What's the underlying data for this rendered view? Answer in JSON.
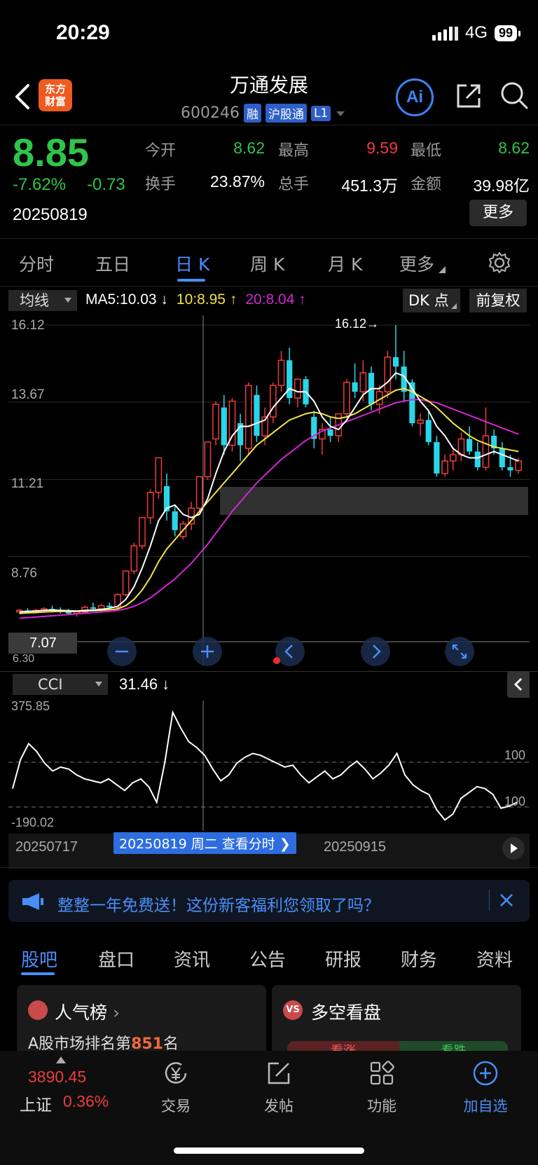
{
  "status": {
    "time": "20:29",
    "network": "4G",
    "battery": "99"
  },
  "header": {
    "logo_text_1": "东方",
    "logo_text_2": "财富",
    "name": "万通发展",
    "code": "600246",
    "tags": [
      "融",
      "沪股通",
      "L1"
    ],
    "ai_label": "Ai"
  },
  "quote": {
    "price": "8.85",
    "change_pct": "-7.62%",
    "change": "-0.73",
    "date": "20250819",
    "open_label": "今开",
    "open": "8.62",
    "high_label": "最高",
    "high": "9.59",
    "low_label": "最低",
    "low": "8.62",
    "turnover_label": "换手",
    "turnover": "23.87%",
    "volume_label": "总手",
    "volume": "451.3万",
    "amount_label": "金额",
    "amount": "39.98亿",
    "more": "更多"
  },
  "kline_tabs": [
    "分时",
    "五日",
    "日 K",
    "周 K",
    "月 K",
    "更多"
  ],
  "active_tab": "日 K",
  "ma_bar": {
    "select": "均线",
    "ma5": "MA5:10.03",
    "ma10": "10:8.95",
    "ma20": "20:8.04",
    "dk_label": "DK 点",
    "fq_label": "前复权",
    "colors": {
      "ma5": "#ffffff",
      "ma10": "#f3e24a",
      "ma20": "#d326d3"
    }
  },
  "chart_labels": {
    "y_ticks": [
      "16.12",
      "13.67",
      "11.21",
      "8.76"
    ],
    "max_marker": "16.12→",
    "left_price": "7.07",
    "left_low_partial": "6.30"
  },
  "chart_data": {
    "type": "candlestick",
    "y_range": [
      6.3,
      16.12
    ],
    "candles": [
      {
        "o": 7.0,
        "h": 7.1,
        "l": 6.95,
        "c": 7.05
      },
      {
        "o": 7.05,
        "h": 7.12,
        "l": 6.98,
        "c": 7.0
      },
      {
        "o": 7.0,
        "h": 7.1,
        "l": 6.95,
        "c": 7.05
      },
      {
        "o": 7.05,
        "h": 7.15,
        "l": 7.0,
        "c": 7.1
      },
      {
        "o": 7.1,
        "h": 7.2,
        "l": 7.0,
        "c": 7.05
      },
      {
        "o": 7.05,
        "h": 7.15,
        "l": 6.95,
        "c": 7.0
      },
      {
        "o": 7.0,
        "h": 7.1,
        "l": 6.9,
        "c": 6.95
      },
      {
        "o": 6.95,
        "h": 7.05,
        "l": 6.85,
        "c": 7.0
      },
      {
        "o": 7.0,
        "h": 7.2,
        "l": 6.95,
        "c": 7.15
      },
      {
        "o": 7.15,
        "h": 7.3,
        "l": 7.05,
        "c": 7.1
      },
      {
        "o": 7.1,
        "h": 7.25,
        "l": 7.0,
        "c": 7.2
      },
      {
        "o": 7.2,
        "h": 7.3,
        "l": 7.1,
        "c": 7.15
      },
      {
        "o": 7.15,
        "h": 7.6,
        "l": 7.1,
        "c": 7.55
      },
      {
        "o": 7.55,
        "h": 8.3,
        "l": 7.5,
        "c": 8.3
      },
      {
        "o": 8.3,
        "h": 9.2,
        "l": 8.2,
        "c": 9.1
      },
      {
        "o": 9.1,
        "h": 10.0,
        "l": 9.0,
        "c": 10.0
      },
      {
        "o": 10.0,
        "h": 10.9,
        "l": 9.8,
        "c": 10.8
      },
      {
        "o": 10.8,
        "h": 11.9,
        "l": 10.6,
        "c": 11.9
      },
      {
        "o": 11.0,
        "h": 11.4,
        "l": 9.9,
        "c": 10.2
      },
      {
        "o": 10.2,
        "h": 10.4,
        "l": 9.4,
        "c": 9.6
      },
      {
        "o": 9.4,
        "h": 9.9,
        "l": 9.3,
        "c": 9.8
      },
      {
        "o": 9.8,
        "h": 10.5,
        "l": 9.6,
        "c": 10.3
      },
      {
        "o": 10.3,
        "h": 11.3,
        "l": 10.2,
        "c": 11.3
      },
      {
        "o": 11.3,
        "h": 12.4,
        "l": 11.2,
        "c": 12.4
      },
      {
        "o": 12.5,
        "h": 13.7,
        "l": 12.3,
        "c": 13.6
      },
      {
        "o": 13.5,
        "h": 13.9,
        "l": 12.0,
        "c": 12.3
      },
      {
        "o": 12.3,
        "h": 13.8,
        "l": 12.1,
        "c": 13.7
      },
      {
        "o": 13.0,
        "h": 13.3,
        "l": 11.8,
        "c": 12.3
      },
      {
        "o": 12.2,
        "h": 14.3,
        "l": 12.0,
        "c": 14.2
      },
      {
        "o": 13.9,
        "h": 14.2,
        "l": 12.4,
        "c": 12.6
      },
      {
        "o": 12.6,
        "h": 13.5,
        "l": 12.3,
        "c": 13.2
      },
      {
        "o": 13.2,
        "h": 14.3,
        "l": 13.0,
        "c": 14.2
      },
      {
        "o": 14.2,
        "h": 15.3,
        "l": 14.0,
        "c": 15.0
      },
      {
        "o": 15.0,
        "h": 15.4,
        "l": 13.6,
        "c": 13.8
      },
      {
        "o": 13.8,
        "h": 14.4,
        "l": 13.5,
        "c": 14.4
      },
      {
        "o": 14.4,
        "h": 14.5,
        "l": 13.5,
        "c": 13.6
      },
      {
        "o": 13.2,
        "h": 13.4,
        "l": 12.2,
        "c": 12.5
      },
      {
        "o": 12.5,
        "h": 13.0,
        "l": 12.0,
        "c": 12.8
      },
      {
        "o": 12.8,
        "h": 13.2,
        "l": 12.4,
        "c": 12.6
      },
      {
        "o": 12.6,
        "h": 13.3,
        "l": 12.4,
        "c": 13.3
      },
      {
        "o": 13.3,
        "h": 14.4,
        "l": 13.2,
        "c": 14.3
      },
      {
        "o": 14.3,
        "h": 14.9,
        "l": 13.8,
        "c": 14.0
      },
      {
        "o": 14.0,
        "h": 15.0,
        "l": 13.7,
        "c": 14.6
      },
      {
        "o": 14.6,
        "h": 14.8,
        "l": 13.4,
        "c": 13.6
      },
      {
        "o": 13.6,
        "h": 14.2,
        "l": 13.3,
        "c": 14.0
      },
      {
        "o": 14.0,
        "h": 15.3,
        "l": 13.8,
        "c": 15.1
      },
      {
        "o": 15.1,
        "h": 16.12,
        "l": 14.4,
        "c": 14.8
      },
      {
        "o": 14.8,
        "h": 15.3,
        "l": 13.7,
        "c": 14.0
      },
      {
        "o": 14.3,
        "h": 14.4,
        "l": 12.9,
        "c": 13.0
      },
      {
        "o": 13.0,
        "h": 13.3,
        "l": 12.6,
        "c": 13.1
      },
      {
        "o": 13.1,
        "h": 13.4,
        "l": 12.3,
        "c": 12.4
      },
      {
        "o": 12.4,
        "h": 12.6,
        "l": 11.3,
        "c": 11.4
      },
      {
        "o": 11.4,
        "h": 12.0,
        "l": 11.3,
        "c": 11.8
      },
      {
        "o": 11.8,
        "h": 12.2,
        "l": 11.5,
        "c": 12.0
      },
      {
        "o": 12.0,
        "h": 12.7,
        "l": 11.8,
        "c": 12.5
      },
      {
        "o": 12.5,
        "h": 12.9,
        "l": 12.0,
        "c": 12.1
      },
      {
        "o": 12.1,
        "h": 12.4,
        "l": 11.5,
        "c": 11.6
      },
      {
        "o": 11.6,
        "h": 13.5,
        "l": 11.5,
        "c": 12.6
      },
      {
        "o": 12.6,
        "h": 12.8,
        "l": 12.0,
        "c": 12.2
      },
      {
        "o": 12.2,
        "h": 12.4,
        "l": 11.5,
        "c": 11.6
      },
      {
        "o": 11.6,
        "h": 12.0,
        "l": 11.3,
        "c": 11.5
      },
      {
        "o": 11.5,
        "h": 11.9,
        "l": 11.4,
        "c": 11.8
      }
    ],
    "ma5": [
      7.0,
      7.02,
      7.03,
      7.05,
      7.06,
      7.05,
      7.04,
      7.03,
      7.05,
      7.06,
      7.08,
      7.12,
      7.18,
      7.4,
      7.8,
      8.4,
      9.1,
      9.9,
      10.3,
      10.4,
      10.1,
      10.0,
      10.1,
      10.6,
      11.4,
      12.1,
      12.6,
      12.9,
      12.9,
      13.0,
      13.1,
      13.5,
      13.8,
      14.1,
      14.0,
      14.0,
      13.7,
      13.2,
      12.9,
      12.8,
      13.1,
      13.5,
      13.9,
      14.1,
      14.1,
      14.3,
      14.6,
      14.5,
      14.1,
      13.7,
      13.4,
      12.9,
      12.6,
      12.2,
      12.0,
      11.9,
      11.9,
      12.0,
      12.1,
      12.0,
      11.9,
      11.8
    ],
    "ma10": [
      6.95,
      6.97,
      6.98,
      7.0,
      7.01,
      7.02,
      7.02,
      7.02,
      7.03,
      7.04,
      7.05,
      7.07,
      7.1,
      7.2,
      7.4,
      7.7,
      8.1,
      8.6,
      9.0,
      9.3,
      9.6,
      9.9,
      10.2,
      10.5,
      10.8,
      11.1,
      11.4,
      11.7,
      12.0,
      12.3,
      12.5,
      12.7,
      12.9,
      13.1,
      13.2,
      13.3,
      13.35,
      13.3,
      13.2,
      13.15,
      13.2,
      13.3,
      13.45,
      13.6,
      13.75,
      13.9,
      14.05,
      14.1,
      14.0,
      13.85,
      13.7,
      13.5,
      13.25,
      13.0,
      12.8,
      12.6,
      12.45,
      12.35,
      12.25,
      12.2,
      12.15,
      12.1
    ],
    "ma20": [
      6.8,
      6.82,
      6.84,
      6.86,
      6.88,
      6.9,
      6.92,
      6.94,
      6.96,
      6.98,
      7.0,
      7.02,
      7.05,
      7.1,
      7.18,
      7.3,
      7.45,
      7.65,
      7.85,
      8.05,
      8.3,
      8.55,
      8.85,
      9.15,
      9.5,
      9.85,
      10.2,
      10.5,
      10.8,
      11.1,
      11.35,
      11.6,
      11.85,
      12.05,
      12.25,
      12.45,
      12.6,
      12.75,
      12.85,
      12.95,
      13.05,
      13.15,
      13.25,
      13.35,
      13.45,
      13.55,
      13.65,
      13.7,
      13.75,
      13.75,
      13.7,
      13.65,
      13.55,
      13.45,
      13.35,
      13.25,
      13.15,
      13.05,
      12.95,
      12.85,
      12.75,
      12.65
    ]
  },
  "cci": {
    "select": "CCI",
    "value": "31.46",
    "top_label": "375.85",
    "bottom_label": "-190.02",
    "ref_upper": "100",
    "ref_lower": "100",
    "series": [
      -10,
      140,
      220,
      180,
      120,
      80,
      100,
      90,
      60,
      40,
      30,
      20,
      40,
      10,
      -20,
      20,
      40,
      0,
      -80,
      120,
      380,
      300,
      230,
      200,
      160,
      90,
      30,
      60,
      120,
      150,
      170,
      160,
      140,
      120,
      100,
      110,
      60,
      20,
      50,
      80,
      40,
      60,
      100,
      130,
      90,
      40,
      70,
      110,
      170,
      60,
      10,
      -20,
      -40,
      -120,
      -170,
      -140,
      -60,
      -30,
      0,
      -10,
      -40,
      -110,
      -100,
      -80
    ]
  },
  "x_axis": {
    "left": "20250717",
    "mid": "20250915",
    "badge": "20250819 周二 查看分时"
  },
  "banner": {
    "text": "整整一年免费送！这份新客福利您领取了吗？"
  },
  "bottom_tabs": [
    "股吧",
    "盘口",
    "资讯",
    "公告",
    "研报",
    "财务",
    "资料"
  ],
  "cards": {
    "left_title": "人气榜",
    "left_sub_pre": "A股市场排名第",
    "left_sub_num": "851",
    "left_sub_post": "名",
    "right_title": "多空看盘",
    "right_a": "看涨",
    "right_b": "看跌"
  },
  "nav": {
    "index_value": "3890.45",
    "index_name": "上证",
    "index_pct": "0.36%",
    "items": [
      "交易",
      "发帖",
      "功能",
      "加自选"
    ]
  }
}
